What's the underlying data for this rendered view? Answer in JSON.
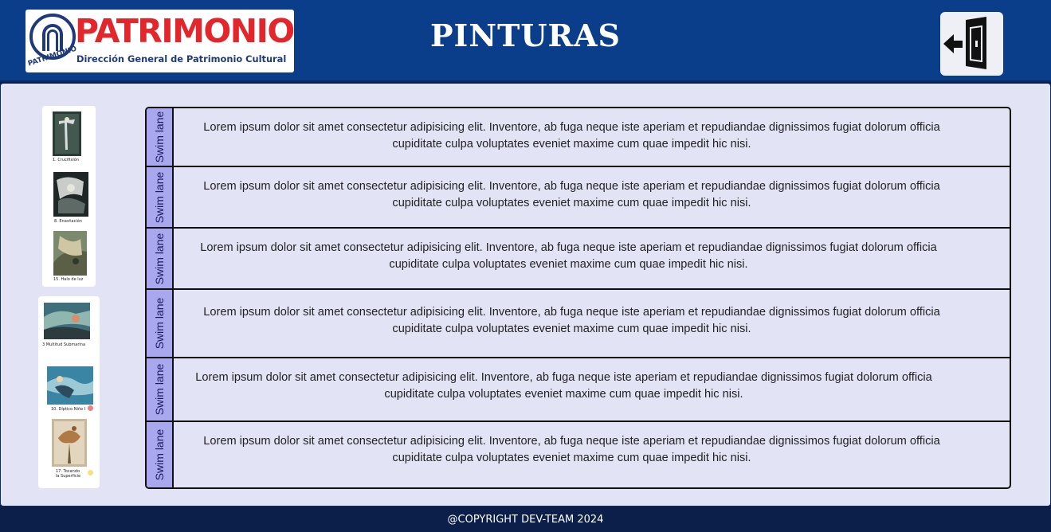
{
  "header": {
    "logo": {
      "title": "PATRIMONIO",
      "arc_text": "PATRIMONIO",
      "subtitle": "Dirección General de Patrimonio Cultural"
    },
    "title": "PINTURAS",
    "logout_icon": "door-exit-icon"
  },
  "gallery": {
    "group1": [
      {
        "caption": "1. Crucifixión"
      },
      {
        "caption": "8. Ensoñación"
      },
      {
        "caption": "15. Halo de luz"
      }
    ],
    "group2": [
      {
        "caption": "3 Multitud Submarina"
      },
      {
        "caption": "10. Díptico Niño I",
        "dot_color": "#f08080"
      },
      {
        "caption": "17. Tocando la Superficie",
        "dot_color": "#f5e27a"
      }
    ]
  },
  "lanes": [
    {
      "label": "Swim lane",
      "text": "Lorem ipsum dolor sit amet consectetur adipisicing elit. Inventore, ab fuga neque iste aperiam et repudiandae dignissimos fugiat dolorum officia cupiditate culpa voluptates eveniet maxime cum quae impedit hic nisi."
    },
    {
      "label": "Swim lane",
      "text": "Lorem ipsum dolor sit amet consectetur adipisicing elit. Inventore, ab fuga neque iste aperiam et repudiandae dignissimos fugiat dolorum officia cupiditate culpa voluptates eveniet maxime cum quae impedit hic nisi."
    },
    {
      "label": "Swim lane",
      "text": "Lorem ipsum dolor sit amet consectetur adipisicing elit. Inventore, ab fuga neque iste aperiam et repudiandae dignissimos fugiat dolorum officia cupiditate culpa voluptates eveniet maxime cum quae impedit hic nisi."
    },
    {
      "label": "Swim lane",
      "text": "Lorem ipsum dolor sit amet consectetur adipisicing elit. Inventore, ab fuga neque iste aperiam et repudiandae dignissimos fugiat dolorum officia cupiditate culpa voluptates eveniet maxime cum quae impedit hic nisi."
    },
    {
      "label": "Swim lane",
      "text": "Lorem ipsum dolor sit amet consectetur adipisicing elit. Inventore, ab fuga neque iste aperiam et repudiandae dignissimos fugiat dolorum officia cupiditate culpa voluptates eveniet maxime cum quae impedit hic nisi."
    },
    {
      "label": "Swim lane",
      "text": "Lorem ipsum dolor sit amet consectetur adipisicing elit. Inventore, ab fuga neque iste aperiam et repudiandae dignissimos fugiat dolorum officia cupiditate culpa voluptates eveniet maxime cum quae impedit hic nisi."
    }
  ],
  "footer": {
    "text": "@COPYRIGHT DEV-TEAM 2024"
  }
}
